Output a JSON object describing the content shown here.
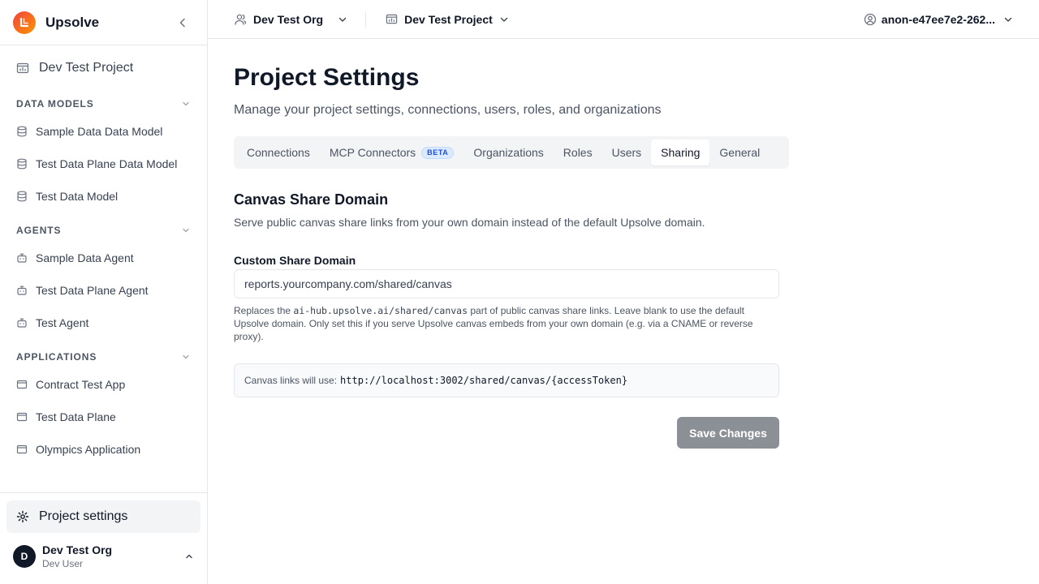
{
  "colors": {
    "accent": "#111827",
    "logo_gradient": [
      "#ef4444",
      "#f97316",
      "#f59e0b"
    ],
    "button_disabled": "#8b8f96",
    "beta_badge": "#1d4ed8"
  },
  "sidebar": {
    "brand": "Upsolve",
    "brand_icon": "upsolve-logo",
    "collapse_icon": "chevron-left-icon",
    "project": {
      "label": "Dev Test Project",
      "icon": "folder-chart-icon"
    },
    "sections": [
      {
        "title": "DATA MODELS",
        "icon": "chevron-down-icon",
        "items": [
          {
            "label": "Sample Data Data Model",
            "icon": "database-icon"
          },
          {
            "label": "Test Data Plane Data Model",
            "icon": "database-icon"
          },
          {
            "label": "Test Data Model",
            "icon": "database-icon"
          }
        ]
      },
      {
        "title": "AGENTS",
        "icon": "chevron-down-icon",
        "items": [
          {
            "label": "Sample Data Agent",
            "icon": "bot-icon"
          },
          {
            "label": "Test Data Plane Agent",
            "icon": "bot-icon"
          },
          {
            "label": "Test Agent",
            "icon": "bot-icon"
          }
        ]
      },
      {
        "title": "APPLICATIONS",
        "icon": "chevron-down-icon",
        "items": [
          {
            "label": "Contract Test App",
            "icon": "app-window-icon"
          },
          {
            "label": "Test Data Plane",
            "icon": "app-window-icon"
          },
          {
            "label": "Olympics Application",
            "icon": "app-window-icon"
          }
        ]
      }
    ],
    "footer": {
      "settings_label": "Project settings",
      "settings_icon": "gear-icon",
      "org_name": "Dev Test Org",
      "org_user": "Dev User",
      "avatar_letter": "D"
    }
  },
  "topbar": {
    "org": {
      "label": "Dev Test Org",
      "icon": "user-icon"
    },
    "project": {
      "label": "Dev Test Project",
      "icon": "folder-chart-icon"
    },
    "user": {
      "label": "anon-e47ee7e2-262...",
      "icon": "user-circle-icon"
    }
  },
  "main": {
    "title": "Project Settings",
    "subtitle": "Manage your project settings, connections, users, roles, and organizations",
    "tabs": [
      {
        "label": "Connections"
      },
      {
        "label": "MCP Connectors",
        "badge": "BETA"
      },
      {
        "label": "Organizations"
      },
      {
        "label": "Roles"
      },
      {
        "label": "Users"
      },
      {
        "label": "Sharing",
        "active": true
      },
      {
        "label": "General"
      }
    ],
    "section": {
      "title": "Canvas Share Domain",
      "description": "Serve public canvas share links from your own domain instead of the default Upsolve domain."
    },
    "field": {
      "label": "Custom Share Domain",
      "placeholder": "reports.yourcompany.com/shared/canvas",
      "value": ""
    },
    "help": {
      "before": "Replaces the ",
      "code": "ai-hub.upsolve.ai/shared/canvas",
      "after": " part of public canvas share links. Leave blank to use the default Upsolve domain. Only set this if you serve Upsolve canvas embeds from your own domain (e.g. via a CNAME or reverse proxy)."
    },
    "preview": {
      "label": "Canvas links will use:",
      "url": "http://localhost:3002/shared/canvas/{accessToken}"
    },
    "save_label": "Save Changes"
  }
}
